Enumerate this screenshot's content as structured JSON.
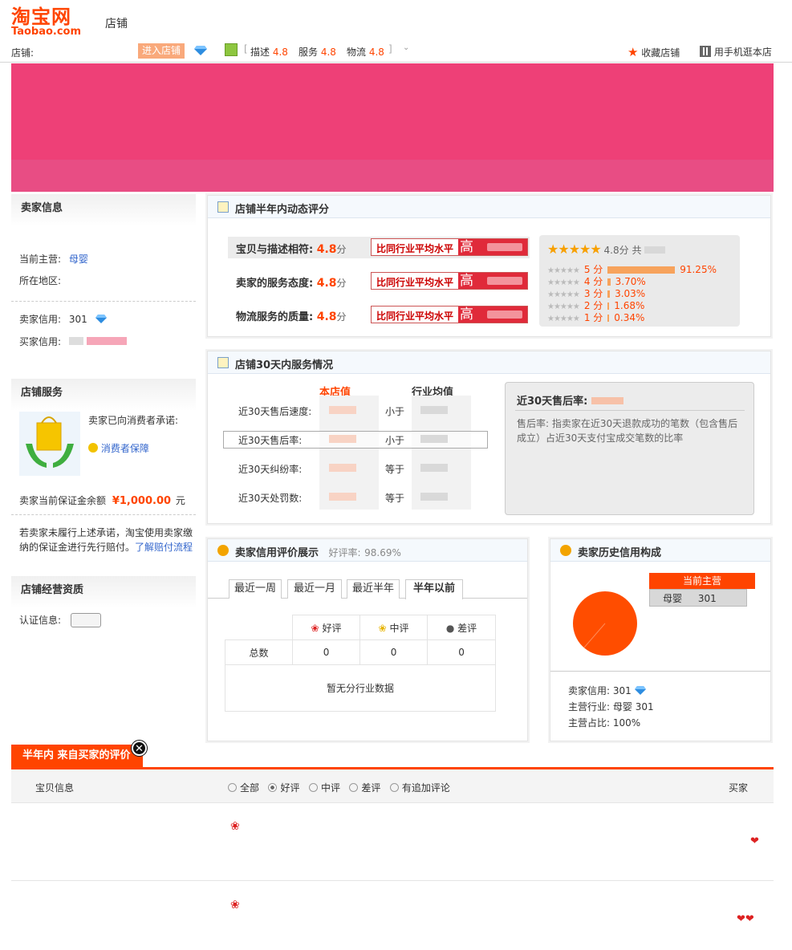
{
  "header": {
    "logo_cn": "淘宝网",
    "logo_en": "Taobao.com",
    "store_word": "店铺",
    "store_label": "店铺:",
    "enter_store": "进入店铺",
    "ratings": [
      {
        "label": "描述",
        "value": "4.8"
      },
      {
        "label": "服务",
        "value": "4.8"
      },
      {
        "label": "物流",
        "value": "4.8"
      }
    ],
    "favorite": "收藏店铺",
    "mobile": "用手机逛本店"
  },
  "sidebar": {
    "seller_info_title": "卖家信息",
    "main_category_label": "当前主营:",
    "main_category_value": "母婴",
    "region_label": "所在地区:",
    "seller_credit_label": "卖家信用:",
    "seller_credit_value": "301",
    "buyer_credit_label": "买家信用:",
    "service_title": "店铺服务",
    "promise_text": "卖家已向消费者承诺:",
    "protection_link": "消费者保障",
    "deposit_label": "卖家当前保证金余额",
    "deposit_value": "¥1,000.00",
    "deposit_unit": "元",
    "notice_line1": "若卖家未履行上述承诺，淘宝使用卖家缴",
    "notice_line2": "纳的保证金进行先行赔付。",
    "notice_link": "了解赔付流程",
    "qual_title": "店铺经营资质",
    "cert_label": "认证信息:"
  },
  "dsr": {
    "title": "店铺半年内动态评分",
    "rows": [
      {
        "label": "宝贝与描述相符:",
        "score": "4.8",
        "unit": "分"
      },
      {
        "label": "卖家的服务态度:",
        "score": "4.8",
        "unit": "分"
      },
      {
        "label": "物流服务的质量:",
        "score": "4.8",
        "unit": "分"
      }
    ],
    "compare_text": "比同行业平均水平",
    "compare_high": "高",
    "overall_score": "4.8",
    "overall_unit": "分 共",
    "distribution": [
      {
        "label": "5 分",
        "pct": "91.25%",
        "value": 91.25
      },
      {
        "label": "4 分",
        "pct": "3.70%",
        "value": 3.7
      },
      {
        "label": "3 分",
        "pct": "3.03%",
        "value": 3.03
      },
      {
        "label": "2 分",
        "pct": "1.68%",
        "value": 1.68
      },
      {
        "label": "1 分",
        "pct": "0.34%",
        "value": 0.34
      }
    ]
  },
  "service30": {
    "title": "店铺30天内服务情况",
    "col_store": "本店值",
    "col_industry": "行业均值",
    "rows": [
      {
        "label": "近30天售后速度:",
        "rel": "小于"
      },
      {
        "label": "近30天售后率:",
        "rel": "小于"
      },
      {
        "label": "近30天纠纷率:",
        "rel": "等于"
      },
      {
        "label": "近30天处罚数:",
        "rel": "等于"
      }
    ],
    "info_title": "近30天售后率:",
    "info_desc_line1": "售后率: 指卖家在近30天退款成功的笔数（包含售后",
    "info_desc_line2": "成立）占近30天支付宝成交笔数的比率"
  },
  "credit": {
    "title": "卖家信用评价展示",
    "good_rate_label": "好评率:",
    "good_rate_value": "98.69%",
    "tabs": [
      "最近一周",
      "最近一月",
      "最近半年",
      "半年以前"
    ],
    "active_tab": "半年以前",
    "cols": [
      "好评",
      "中评",
      "差评"
    ],
    "total_label": "总数",
    "totals": [
      "0",
      "0",
      "0"
    ],
    "empty_text": "暂无分行业数据"
  },
  "history": {
    "title": "卖家历史信用构成",
    "badge": "当前主营",
    "category": "母婴",
    "category_value": "301",
    "seller_credit_label": "卖家信用:",
    "seller_credit_value": "301",
    "industry_label": "主营行业:",
    "industry_value": "母婴 301",
    "ratio_label": "主营占比:",
    "ratio_value": "100%",
    "chart_color": "#ff4d00"
  },
  "reviews": {
    "tab_title": "半年内 来自买家的评价",
    "col_item": "宝贝信息",
    "col_buyer": "买家",
    "filters": [
      "全部",
      "好评",
      "中评",
      "差评",
      "有追加评论"
    ],
    "selected_filter": "好评"
  }
}
